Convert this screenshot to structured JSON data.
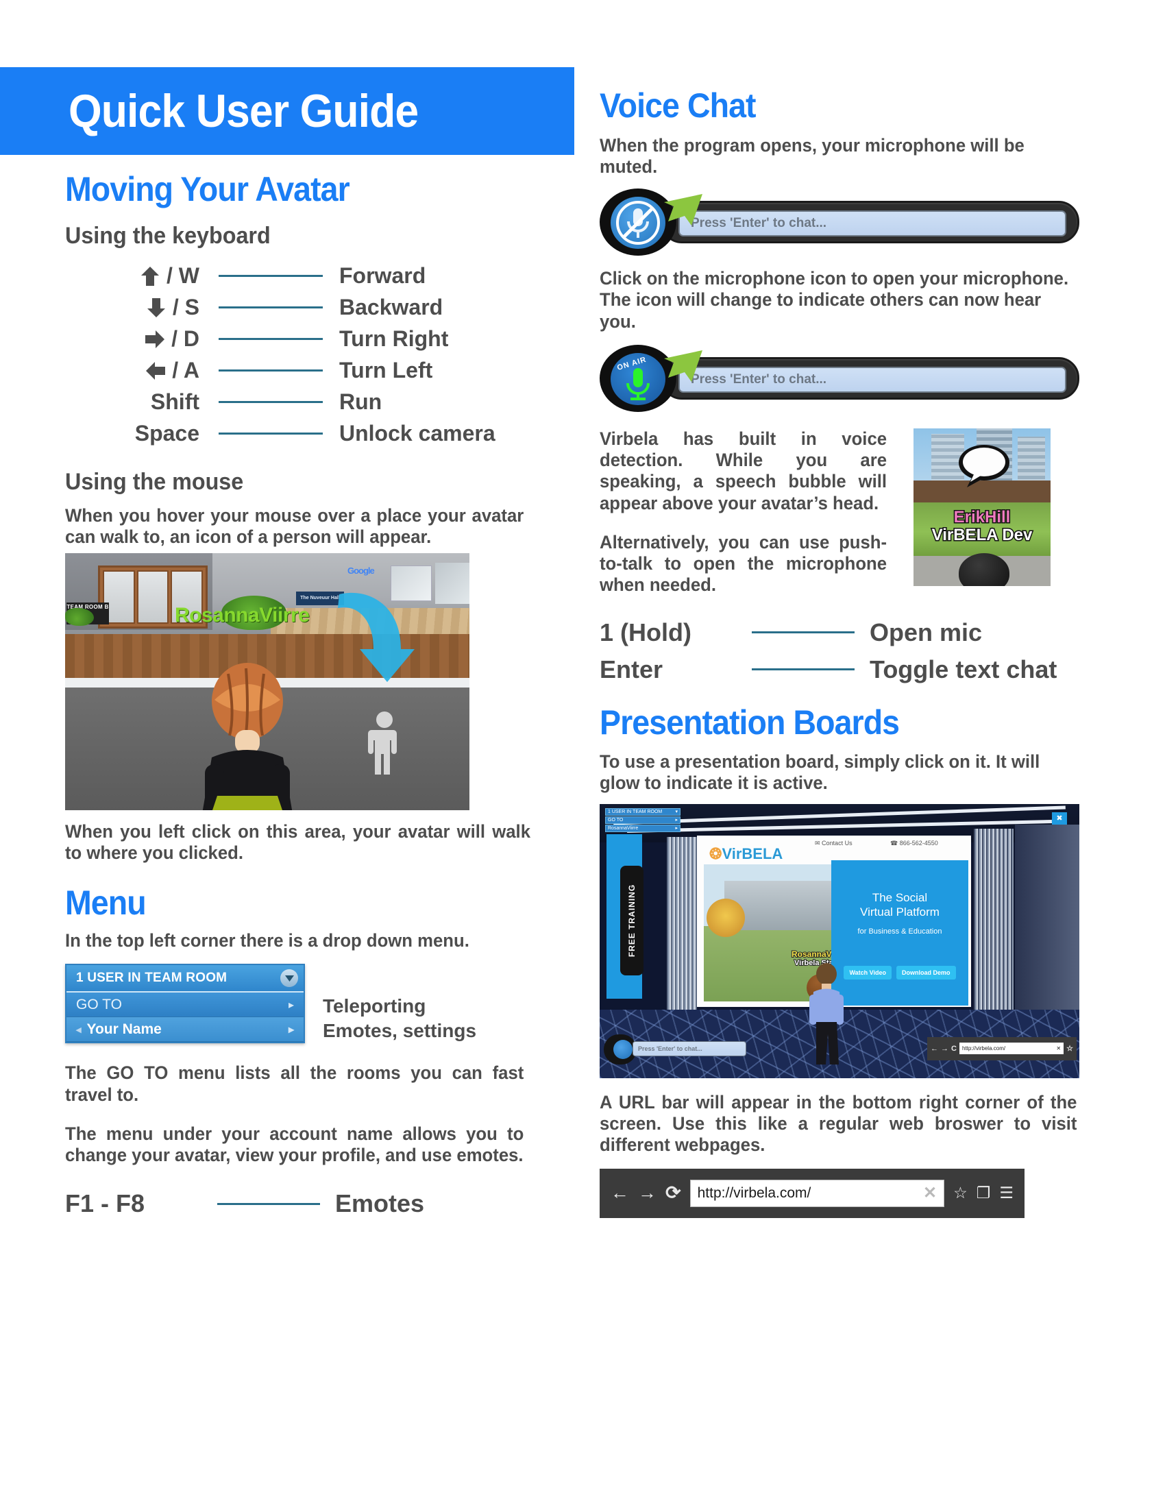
{
  "banner": {
    "title": "Quick User Guide"
  },
  "left": {
    "moving_heading": "Moving Your Avatar",
    "keyboard_heading": "Using the keyboard",
    "keyboard_rows": [
      {
        "icon": "arrow-up-icon",
        "key": "/ W",
        "action": "Forward"
      },
      {
        "icon": "arrow-down-icon",
        "key": "/ S",
        "action": "Backward"
      },
      {
        "icon": "arrow-right-icon",
        "key": "/ D",
        "action": "Turn Right"
      },
      {
        "icon": "arrow-left-icon",
        "key": "/ A",
        "action": "Turn Left"
      },
      {
        "icon": "",
        "key": "Shift",
        "action": "Run"
      },
      {
        "icon": "",
        "key": "Space",
        "action": "Unlock camera"
      }
    ],
    "mouse_heading": "Using the mouse",
    "mouse_text": "When you hover your mouse over a place your avatar can walk to, an icon of a person will appear.",
    "walk_shot": {
      "avatar_name": "RosannaViirre",
      "room_sign": "TEAM ROOM B",
      "hall_sign": "The Nuveuur Hall",
      "google_label": "Google"
    },
    "click_text": "When you left click on this area, your avatar will walk to where you clicked.",
    "menu_heading": "Menu",
    "menu_text": "In the top left corner there is a drop down menu.",
    "menu_widget": {
      "header": "1 USER IN TEAM ROOM",
      "rows": [
        "GO TO",
        "Your Name"
      ]
    },
    "menu_captions": [
      "Teleporting",
      "Emotes, settings"
    ],
    "goto_text": "The GO TO menu lists all the rooms you can fast travel to.",
    "account_text": "The menu under your account name allows you to change your avatar, view your profile, and use emotes.",
    "emote_row": {
      "key": "F1 - F8",
      "action": "Emotes"
    }
  },
  "right": {
    "voice_heading": "Voice Chat",
    "muted_text": "When the program opens, your microphone will be muted.",
    "chat_placeholder": "Press 'Enter' to chat...",
    "mic_on_label": "ON AIR",
    "click_mic_text": "Click on the microphone icon to open your microphone. The icon will change to indicate others can now hear you.",
    "detection_text": "Virbela has built in voice detection. While you are speaking, a speech bubble will appear above your avatar’s head.",
    "ptt_text": "Alternatively, you can use push-to-talk to open the microphone when needed.",
    "erik_shot": {
      "name": "ErikHill",
      "role": "VirBELA Dev"
    },
    "voice_rows": [
      {
        "key": "1 (Hold)",
        "action": "Open mic"
      },
      {
        "key": "Enter",
        "action": "Toggle text chat"
      }
    ],
    "boards_heading": "Presentation Boards",
    "boards_text": "To use a presentation board, simply click on it. It will glow to indicate it is active.",
    "board_shot": {
      "menu_header": "1 USER IN TEAM ROOM",
      "menu_rows": [
        "GO TO",
        "RosannaViirre"
      ],
      "free_training": "FREE TRAINING",
      "site_logo": "VirBELA",
      "contact": "Contact Us",
      "phone": "866-562-4550",
      "cta_title": "The Social\nVirtual Platform",
      "cta_sub": "for Business & Education",
      "cta_buttons": [
        "Watch Video",
        "Download Demo"
      ],
      "avatar_name": "RosannaViirre",
      "avatar_role": "Virbela Staff",
      "chat_placeholder": "Press 'Enter' to chat...",
      "url": "http://virbela.com/"
    },
    "url_text": "A URL bar will appear in the bottom right corner of the screen. Use this like a regular web broswer to visit different webpages.",
    "url_bar": {
      "back": "←",
      "forward": "→",
      "reload": "⟳",
      "url": "http://virbela.com/",
      "clear": "✕",
      "star": "☆",
      "cast": "❐",
      "menu": "☰"
    }
  },
  "colors": {
    "accent_blue": "#1a7ef5",
    "body_gray": "#4d4d4d",
    "rule_teal": "#2a6f8a"
  }
}
